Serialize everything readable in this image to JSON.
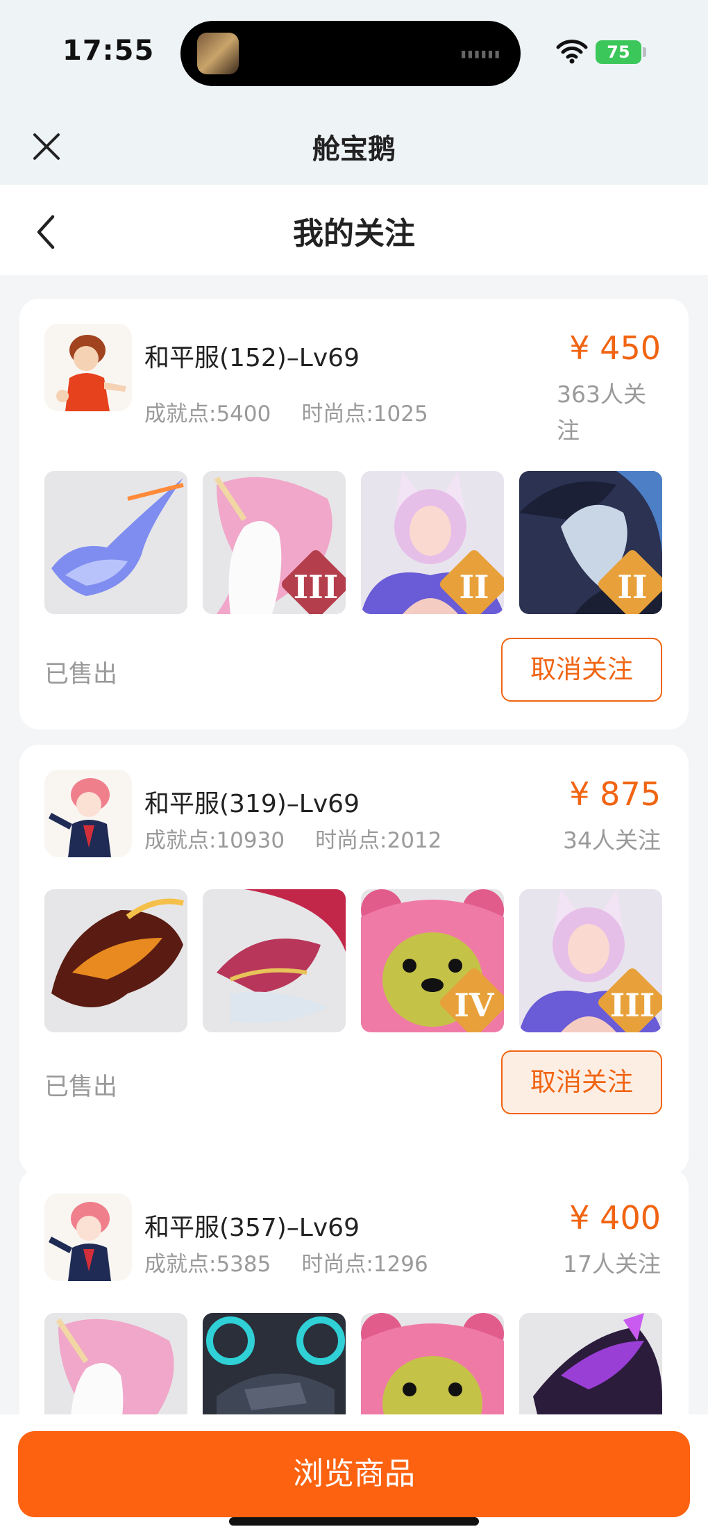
{
  "status_bar": {
    "time": "17:55",
    "battery": "75"
  },
  "header": {
    "app_title": "舱宝鹅",
    "page_title": "我的关注"
  },
  "colors": {
    "accent": "#f06412",
    "button": "#fd6210",
    "muted": "#9a9a9a"
  },
  "items": [
    {
      "server": "和平服(152)–Lv69",
      "achievement": "成就点:5400",
      "fashion": "时尚点:1025",
      "price": "¥ 450",
      "followers": "363人关注",
      "status": "已售出",
      "unfollow_label": "取消关注",
      "thumbs": [
        {
          "icon": "blue-dragon-mount",
          "tier": ""
        },
        {
          "icon": "unicorn-mount",
          "tier": "III"
        },
        {
          "icon": "fox-spirit-character",
          "tier": "II"
        },
        {
          "icon": "dark-dragon-mount",
          "tier": "II"
        }
      ]
    },
    {
      "server": "和平服(319)–Lv69",
      "achievement": "成就点:10930",
      "fashion": "时尚点:2012",
      "price": "¥ 875",
      "followers": "34人关注",
      "status": "已售出",
      "unfollow_label": "取消关注",
      "thumbs": [
        {
          "icon": "fire-dragon-mount",
          "tier": ""
        },
        {
          "icon": "red-dragon-mount",
          "tier": ""
        },
        {
          "icon": "pink-bear-pet",
          "tier": "IV"
        },
        {
          "icon": "fox-spirit-character",
          "tier": "III"
        }
      ]
    },
    {
      "server": "和平服(357)–Lv69",
      "achievement": "成就点:5385",
      "fashion": "时尚点:1296",
      "price": "¥ 400",
      "followers": "17人关注",
      "thumbs": [
        {
          "icon": "unicorn-mount",
          "tier": ""
        },
        {
          "icon": "mech-dragon-mount",
          "tier": ""
        },
        {
          "icon": "pink-bear-pet",
          "tier": ""
        },
        {
          "icon": "purple-dragon-mount",
          "tier": ""
        }
      ]
    }
  ],
  "bottom_button": "浏览商品"
}
